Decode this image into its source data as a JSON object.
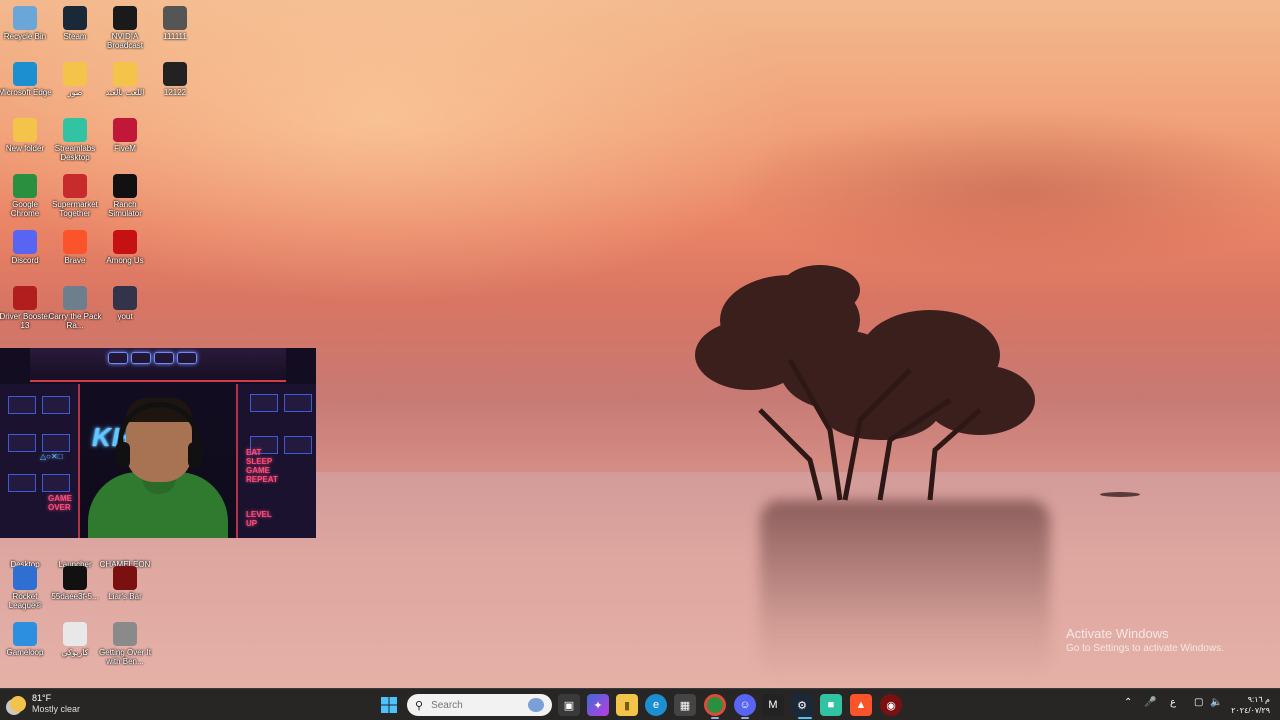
{
  "desktop": {
    "icons": [
      {
        "label": "Recycle Bin",
        "icon": "recycle-bin-icon",
        "color": "#6aa6d8"
      },
      {
        "label": "Steam",
        "icon": "steam-icon",
        "color": "#1b2838"
      },
      {
        "label": "NVIDIA Broadcast",
        "icon": "nvidia-broadcast-icon",
        "color": "#1a1a1a"
      },
      {
        "label": "111111",
        "icon": "file-icon",
        "color": "#555555"
      },
      {
        "label": "Microsoft Edge",
        "icon": "edge-icon",
        "color": "#1c8fd0"
      },
      {
        "label": "صور",
        "icon": "folder-icon",
        "color": "#f3c449"
      },
      {
        "label": "اللعب بالعبد",
        "icon": "folder-icon",
        "color": "#f3c449"
      },
      {
        "label": "12122",
        "icon": "video-file-icon",
        "color": "#222222"
      },
      {
        "label": "New folder",
        "icon": "folder-icon",
        "color": "#f3c449"
      },
      {
        "label": "Streamlabs Desktop",
        "icon": "streamlabs-icon",
        "color": "#31c3a2"
      },
      {
        "label": "FiveM",
        "icon": "fivem-icon",
        "color": "#c1183a"
      },
      {
        "label": "Google Chrome",
        "icon": "chrome-icon",
        "color": "#2a8f3f"
      },
      {
        "label": "Supermarket Together",
        "icon": "supermarket-together-icon",
        "color": "#c82b2b"
      },
      {
        "label": "Ranch Simulator",
        "icon": "ranch-simulator-icon",
        "color": "#111111"
      },
      {
        "label": "Discord",
        "icon": "discord-icon",
        "color": "#5865f2"
      },
      {
        "label": "Brave",
        "icon": "brave-icon",
        "color": "#fb542b"
      },
      {
        "label": "Among Us",
        "icon": "among-us-icon",
        "color": "#c51111"
      },
      {
        "label": "Driver Booster 13",
        "icon": "driver-booster-icon",
        "color": "#b21e1e"
      },
      {
        "label": "Carry the Pack Ra...",
        "icon": "carry-the-pack-icon",
        "color": "#6d7f8c"
      },
      {
        "label": "yout",
        "icon": "video-file-icon",
        "color": "#33334a"
      },
      {
        "label": "Desktop",
        "icon": "desktop-icon",
        "color": "#444444"
      },
      {
        "label": "Launcher",
        "icon": "epic-launcher-icon",
        "color": "#333333"
      },
      {
        "label": "CHAMELEON",
        "icon": "chameleon-icon",
        "color": "#333333"
      },
      {
        "label": "Rocket League®",
        "icon": "rocket-league-icon",
        "color": "#2f6fd1"
      },
      {
        "label": "55daee3f-5...",
        "icon": "video-file-icon",
        "color": "#111111"
      },
      {
        "label": "Liar's Bar",
        "icon": "liars-bar-icon",
        "color": "#7a1010"
      },
      {
        "label": "Gameloop",
        "icon": "gameloop-icon",
        "color": "#2d8fe0"
      },
      {
        "label": "كاريوكي",
        "icon": "podcast-icon",
        "color": "#e8e8e8"
      },
      {
        "label": "Getting Over It with Ben...",
        "icon": "getting-over-it-icon",
        "color": "#8a8a8a"
      }
    ]
  },
  "webcam": {
    "neon_left": "KHA",
    "neon_right": "A",
    "sign_game_over": "GAME OVER",
    "sign_level_up": "LEVEL UP",
    "sign_eat_sleep": "EAT SLEEP GAME REPEAT",
    "sign_ps": "△○✕□"
  },
  "activation": {
    "title": "Activate Windows",
    "subtitle": "Go to Settings to activate Windows."
  },
  "taskbar": {
    "weather_temp": "81°F",
    "weather_condition": "Mostly clear",
    "search_placeholder": "Search",
    "tray_lang": "ع",
    "clock_time": "م ٩:١٦",
    "clock_date": "٢٠٢٤/٠٧/٢٩"
  },
  "colors": {
    "taskbar_bg": "#202020",
    "accent": "#4cc2ff"
  }
}
